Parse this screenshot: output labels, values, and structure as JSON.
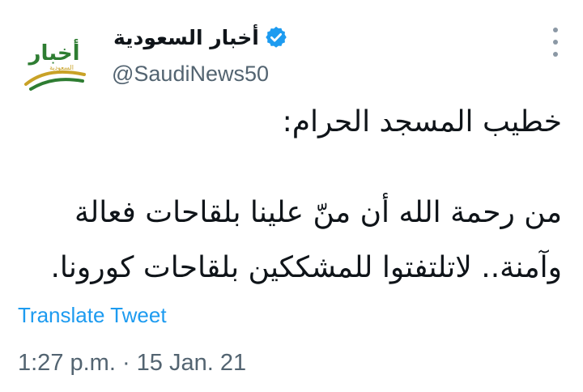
{
  "tweet": {
    "display_name": "أخبار السعودية",
    "handle": "@SaudiNews50",
    "verified": true,
    "avatar_logo_text": "أخبار",
    "avatar_logo_subtext": "السعودية",
    "text_lines": [
      "خطيب المسجد الحرام:",
      "من رحمة الله أن منّ علينا بلقاحات فعالة",
      "وآمنة.. لاتلتفتوا للمشككين بلقاحات كورونا."
    ],
    "translate_label": "Translate Tweet",
    "timestamp": "1:27 p.m. · 15 Jan. 21"
  },
  "colors": {
    "verified_badge": "#1d9bf0",
    "link": "#1d9bf0",
    "secondary_text": "#536471",
    "logo_green": "#2e7d32",
    "logo_gold": "#c9a227"
  },
  "icons": {
    "verified": "verified-badge-icon",
    "more": "more-options-icon"
  }
}
